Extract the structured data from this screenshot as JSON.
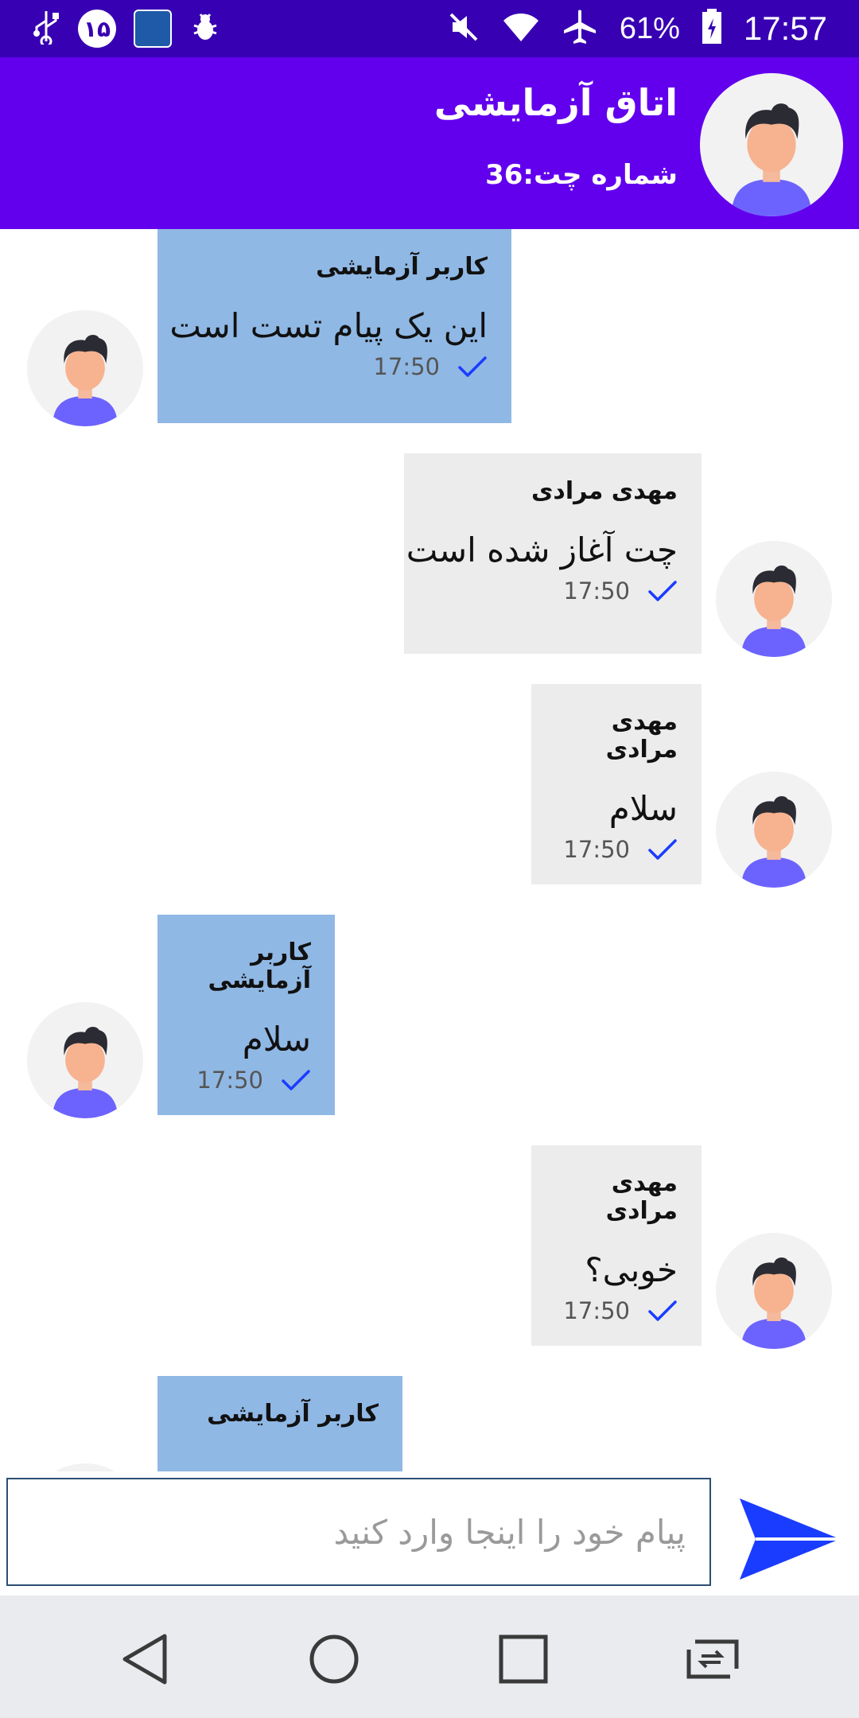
{
  "status_bar": {
    "notification_badge": "۱۵",
    "battery_percent": "61%",
    "time": "17:57",
    "icons": [
      "usb-icon",
      "notification-badge-icon",
      "dictionary-app-icon",
      "bug-icon",
      "mute-icon",
      "wifi-icon",
      "airplane-icon",
      "battery-icon"
    ]
  },
  "header": {
    "title": "اتاق آزمایشی",
    "subtitle": "شماره چت:36"
  },
  "messages": [
    {
      "sender": "کاربر آزمایشی",
      "text": "این یک پیام تست است",
      "time": "17:50",
      "side": "other"
    },
    {
      "sender": "مهدی مرادی",
      "text": "چت آغاز شده است",
      "time": "17:50",
      "side": "me"
    },
    {
      "sender": "مهدی مرادی",
      "text": "سلام",
      "time": "17:50",
      "side": "me"
    },
    {
      "sender": "کاربر آزمایشی",
      "text": "سلام",
      "time": "17:50",
      "side": "other"
    },
    {
      "sender": "مهدی مرادی",
      "text": "خوبی؟",
      "time": "17:50",
      "side": "me"
    },
    {
      "sender": "کاربر آزمایشی",
      "text": "",
      "time": "",
      "side": "other"
    }
  ],
  "input": {
    "placeholder": "پیام خود را اینجا وارد کنید",
    "value": ""
  },
  "colors": {
    "status_bar": "#3700b3",
    "app_bar": "#6200ee",
    "bubble_other": "#90b8e4",
    "bubble_me": "#ececec",
    "send_icon": "#1a3cff",
    "check": "#1a3cff"
  }
}
